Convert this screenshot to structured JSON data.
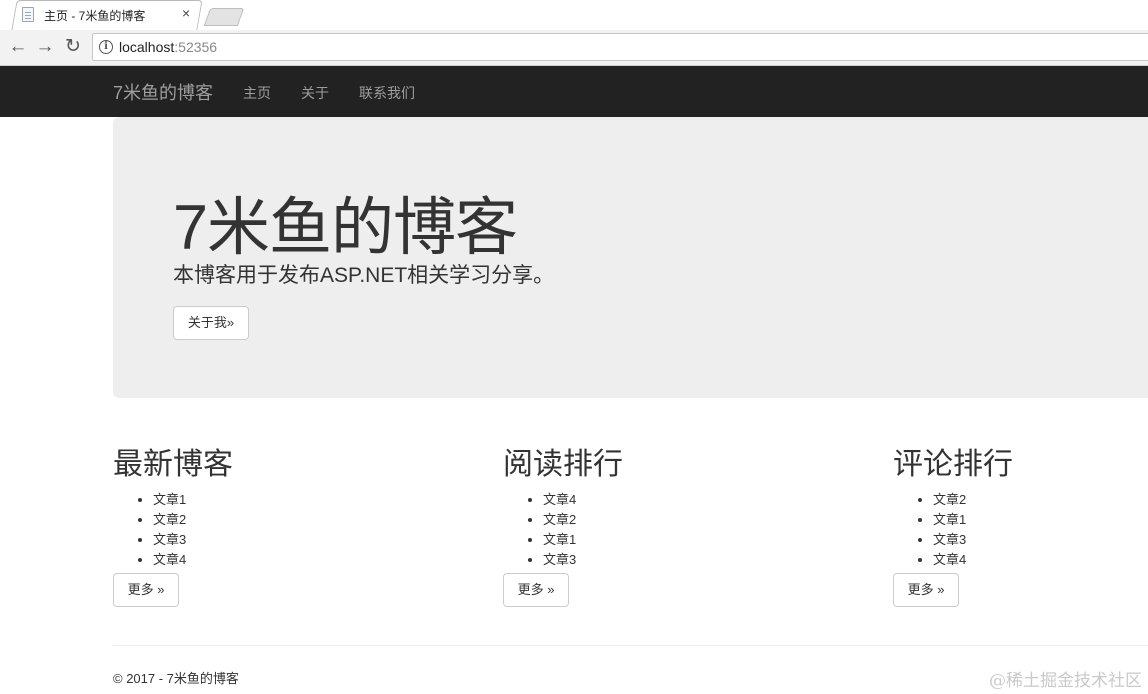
{
  "browser": {
    "tab_title": "主页 - 7米鱼的博客",
    "tab_close": "×",
    "url_host": "localhost",
    "url_port": ":52356",
    "back_icon": "←",
    "forward_icon": "→",
    "reload_icon": "↻"
  },
  "navbar": {
    "brand": "7米鱼的博客",
    "links": [
      "主页",
      "关于",
      "联系我们"
    ]
  },
  "jumbotron": {
    "title": "7米鱼的博客",
    "lead": "本博客用于发布ASP.NET相关学习分享。",
    "button": "关于我»"
  },
  "sections": [
    {
      "heading": "最新博客",
      "items": [
        "文章1",
        "文章2",
        "文章3",
        "文章4"
      ],
      "button": "更多 »"
    },
    {
      "heading": "阅读排行",
      "items": [
        "文章4",
        "文章2",
        "文章1",
        "文章3"
      ],
      "button": "更多 »"
    },
    {
      "heading": "评论排行",
      "items": [
        "文章2",
        "文章1",
        "文章3",
        "文章4"
      ],
      "button": "更多 »"
    }
  ],
  "footer": {
    "text": "© 2017 - 7米鱼的博客"
  },
  "watermark": "@稀土掘金技术社区"
}
